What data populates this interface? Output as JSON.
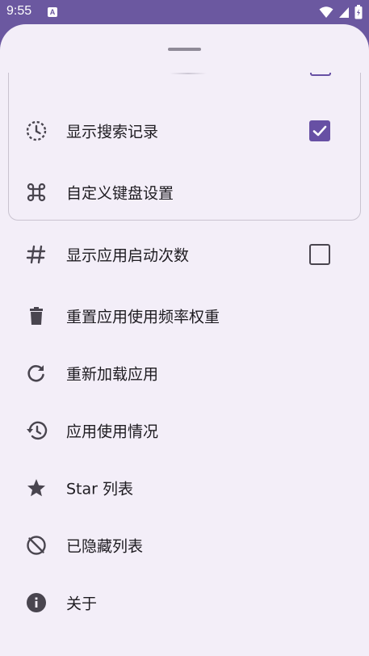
{
  "status_bar": {
    "time": "9:55",
    "app_icon_letter": "A",
    "icons": [
      "wifi-icon",
      "signal-icon",
      "battery-icon"
    ]
  },
  "colors": {
    "accent": "#6750a4",
    "status_bar": "#6b58a0",
    "sheet_background": "#f3eef8",
    "text": "#1d1b20",
    "icon": "#49454f"
  },
  "menu": {
    "items": [
      {
        "icon": "history-icon",
        "label": "显示搜索记录",
        "checkbox": true,
        "checked": true
      },
      {
        "icon": "command-key-icon",
        "label": "自定义键盘设置"
      },
      {
        "icon": "hashtag-icon",
        "label": "显示应用启动次数",
        "checkbox": true,
        "checked": false
      },
      {
        "icon": "trash-icon",
        "label": "重置应用使用频率权重"
      },
      {
        "icon": "refresh-icon",
        "label": "重新加载应用"
      },
      {
        "icon": "restore-history-icon",
        "label": "应用使用情况"
      },
      {
        "icon": "star-icon",
        "label": "Star 列表"
      },
      {
        "icon": "hidden-icon",
        "label": "已隐藏列表"
      },
      {
        "icon": "info-icon",
        "label": "关于"
      }
    ]
  }
}
